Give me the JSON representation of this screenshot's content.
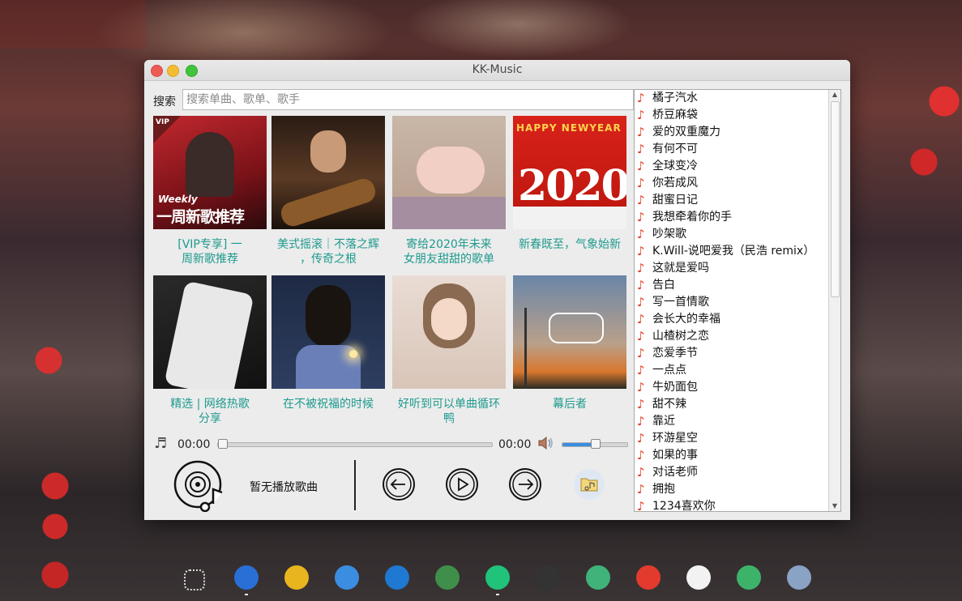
{
  "window": {
    "title": "KK-Music"
  },
  "search": {
    "label": "搜索",
    "placeholder": "搜索单曲、歌单、歌手"
  },
  "cards": [
    {
      "caption": "[VIP专享] 一\n周新歌推荐",
      "badge": "VIP",
      "overlay_small": "Weekly",
      "overlay_big": "一周新歌推荐"
    },
    {
      "caption": "美式摇滚｜不落之辉\n，传奇之根"
    },
    {
      "caption": "寄给2020年未来\n女朋友甜甜的歌单"
    },
    {
      "caption": "新春既至，气象始新",
      "overlay_small": "HAPPY NEWYEAR",
      "overlay_big": "2020"
    },
    {
      "caption": "精选 | 网络热歌\n分享"
    },
    {
      "caption": "在不被祝福的时候"
    },
    {
      "caption": "好听到可以单曲循环\n鸭"
    },
    {
      "caption": "幕后者"
    }
  ],
  "player": {
    "current_time": "00:00",
    "total_time": "00:00",
    "progress": 0.0,
    "volume": 0.5,
    "now_playing": "暂无播放歌曲",
    "accent_color": "#3a8de0"
  },
  "playlist": [
    "橘子汽水",
    "桥豆麻袋",
    "爱的双重魔力",
    "有何不可",
    "全球变冷",
    "你若成风",
    "甜蜜日记",
    "我想牵着你的手",
    "吵架歌",
    "K.Will-说吧爱我（民浩 remix）",
    "这就是爱吗",
    "告白",
    "写一首情歌",
    "会长大的幸福",
    "山楂树之恋",
    "恋爱季节",
    "一点点",
    "牛奶面包",
    "甜不辣",
    "靠近",
    "环游星空",
    "如果的事",
    "对话老师",
    "拥抱",
    "1234喜欢你"
  ],
  "dock": [
    {
      "name": "apps-grid-icon",
      "color": "#555555"
    },
    {
      "name": "firefox-icon",
      "color": "#2a6fd6"
    },
    {
      "name": "chrome-icon",
      "color": "#e8b51e"
    },
    {
      "name": "chat-bubble-icon",
      "color": "#3a8de0"
    },
    {
      "name": "vscode-icon",
      "color": "#1f78d1"
    },
    {
      "name": "android-studio-icon",
      "color": "#3f8f4a"
    },
    {
      "name": "pycharm-icon",
      "color": "#21c27a"
    },
    {
      "name": "obs-icon",
      "color": "#333333"
    },
    {
      "name": "video-icon",
      "color": "#3fb37a"
    },
    {
      "name": "netease-music-icon",
      "color": "#e23b2e"
    },
    {
      "name": "typora-icon",
      "color": "#f2f2f2"
    },
    {
      "name": "telegram-icon",
      "color": "#3db36a"
    },
    {
      "name": "user-avatar-icon",
      "color": "#8aa2c4"
    }
  ]
}
